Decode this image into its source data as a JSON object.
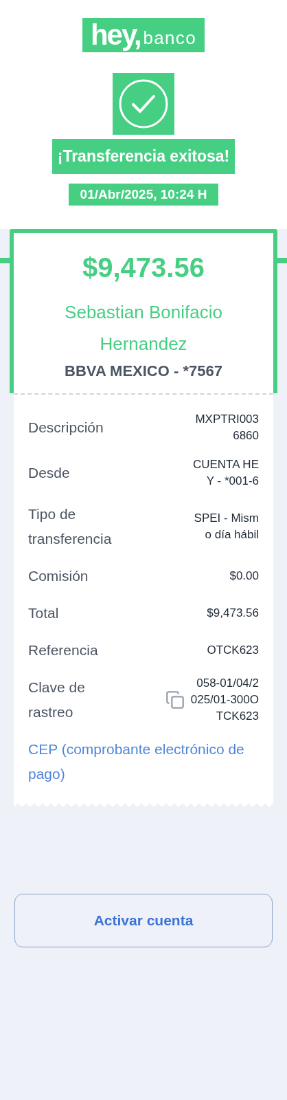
{
  "brand": {
    "logo": "hey,",
    "name": "banco"
  },
  "status": {
    "title": "¡Transferencia exitosa!",
    "date_line": "01/Abr/2025, 10:24",
    "date_suffix": "H"
  },
  "receipt": {
    "amount": "$9,473.56",
    "recipient": "Sebastian Bonifacio Hernandez",
    "bank": "BBVA MEXICO - *7567",
    "rows": [
      {
        "label": "Descripción",
        "value": "MXPTRI0036860",
        "copyable": false
      },
      {
        "label": "Desde",
        "value": "CUENTA HEY - *001-6",
        "copyable": false
      },
      {
        "label": "Tipo de transferencia",
        "value": "SPEI - Mismo día hábil",
        "copyable": false
      },
      {
        "label": "Comisión",
        "value": "$0.00",
        "copyable": false
      },
      {
        "label": "Total",
        "value": "$9,473.56",
        "copyable": false
      },
      {
        "label": "Referencia",
        "value": "OTCK623",
        "copyable": false
      },
      {
        "label": "Clave de rastreo",
        "value": "058-01/04/2025/01-300OTCK623",
        "copyable": true
      }
    ],
    "link": "CEP (comprobante electrónico de pago)"
  },
  "button": "Activar cuenta"
}
